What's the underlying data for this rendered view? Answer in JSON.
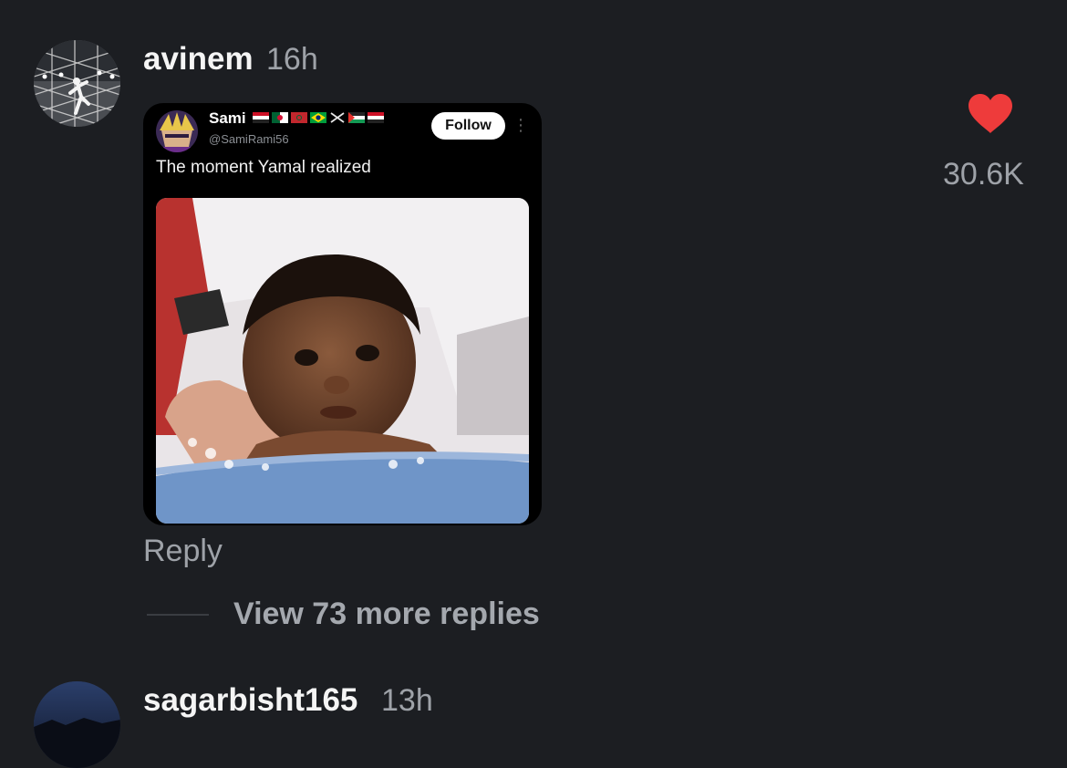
{
  "comments": [
    {
      "username": "avinem",
      "time": "16h",
      "avatar_icon": "football-player-avatar",
      "embed": {
        "name": "Sami",
        "flags": [
          "egypt",
          "algeria",
          "morocco",
          "brazil",
          "crossed-swords",
          "palestine",
          "egypt"
        ],
        "handle": "@SamiRami56",
        "follow_label": "Follow",
        "text": "The moment Yamal realized",
        "image": "baby-in-bath-photo"
      },
      "likes": "30.6K",
      "like_icon": "heart-icon",
      "like_color": "#ee3b3b",
      "reply_label": "Reply",
      "view_replies_label": "View 73 more replies"
    },
    {
      "username": "sagarbisht165",
      "time": "13h",
      "avatar_icon": "night-sky-avatar"
    }
  ]
}
